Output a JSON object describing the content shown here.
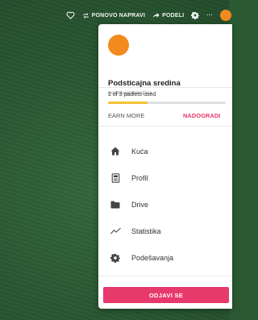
{
  "topbar": {
    "remake_label": "PONOVO NAPRAVI",
    "share_label": "PODELI",
    "more_label": "···"
  },
  "profile": {
    "name": "Podsticajna sredina",
    "handle": "podsticajnasredina",
    "avatar_color": "#f28a1f"
  },
  "usage": {
    "text": "1 of 3 padlets used",
    "used": 1,
    "total": 3
  },
  "actions": {
    "earn_more": "EARN MORE",
    "upgrade": "NADOGRADI"
  },
  "menu": [
    {
      "label": "Kuća",
      "icon": "home-icon"
    },
    {
      "label": "Profil",
      "icon": "profile-card-icon"
    },
    {
      "label": "Drive",
      "icon": "folder-icon"
    },
    {
      "label": "Statistika",
      "icon": "trend-line-icon"
    },
    {
      "label": "Podešavanja",
      "icon": "gear-icon"
    }
  ],
  "logout_label": "ODJAVI SE",
  "colors": {
    "accent": "#e8396b",
    "progress": "#f2c233",
    "background": "#2b5a32"
  }
}
